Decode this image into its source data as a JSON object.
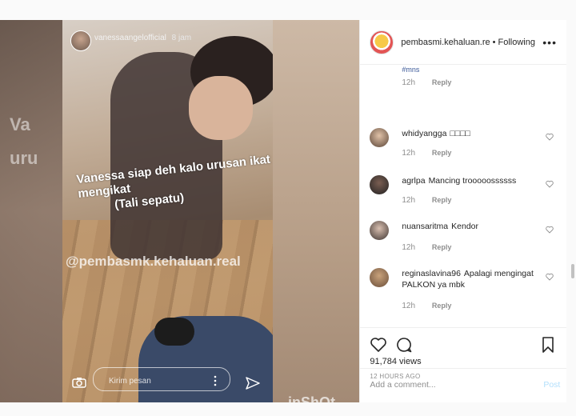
{
  "story": {
    "username": "vanessaangelofficial",
    "time": "8 jam",
    "caption_line1": "Vanessa siap deh kalo urusan ikat mengikat",
    "caption_line2": "(Tali sepatu)",
    "watermark": "@pembasmk.kehaluan.real",
    "message_placeholder": "Kirim pesan",
    "brand": "inShOt",
    "bg_text_1": "Va",
    "bg_text_2": "uru"
  },
  "header": {
    "username": "pembasmi.kehaluan.re",
    "separator": "•",
    "follow_status": "Following",
    "more": "•••"
  },
  "comments": [
    {
      "user": "",
      "text": "#mns",
      "time": "12h",
      "reply": "Reply"
    },
    {
      "user": "whidyangga",
      "text": "□□□□",
      "time": "12h",
      "reply": "Reply"
    },
    {
      "user": "agrlpa",
      "text": "Mancing trooooossssss",
      "time": "12h",
      "reply": "Reply"
    },
    {
      "user": "nuansaritma",
      "text": "Kendor",
      "time": "12h",
      "reply": "Reply"
    },
    {
      "user": "reginaslavina96",
      "text": "Apalagi mengingat PALKON ya mbk",
      "time": "12h",
      "reply": "Reply"
    }
  ],
  "post": {
    "views": "91,784 views",
    "time_ago": "12 HOURS AGO",
    "add_comment_placeholder": "Add a comment...",
    "post_label": "Post"
  },
  "colors": {
    "accent_blue": "#b2dffc",
    "text_primary": "#262626",
    "text_secondary": "#8e8e8e"
  }
}
